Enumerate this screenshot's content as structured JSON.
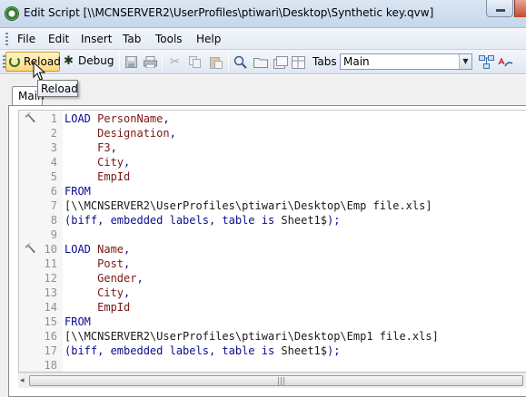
{
  "window": {
    "title": "Edit Script [\\\\MCNSERVER2\\UserProfiles\\ptiwari\\Desktop\\Synthetic key.qvw]"
  },
  "menu": {
    "items": [
      "File",
      "Edit",
      "Insert",
      "Tab",
      "Tools",
      "Help"
    ]
  },
  "toolbar": {
    "reload_label": "Reload",
    "debug_label": "Debug",
    "tabs_label": "Tabs",
    "tabs_selected": "Main",
    "icons": [
      "save-icon",
      "print-icon",
      "cut-icon",
      "copy-icon",
      "paste-icon",
      "find-icon",
      "open-folder-icon",
      "table-files-icon",
      "table-icon",
      "tab-icon",
      "variables-icon"
    ]
  },
  "tooltip": {
    "text": "Reload"
  },
  "tabs": [
    {
      "label": "Main"
    }
  ],
  "editor": {
    "lines": [
      {
        "n": "1",
        "parts": [
          [
            "kw",
            "LOAD "
          ],
          [
            "fld",
            "PersonName"
          ],
          [
            "kw",
            ","
          ]
        ]
      },
      {
        "n": "2",
        "parts": [
          [
            "kw",
            "     "
          ],
          [
            "fld",
            "Designation"
          ],
          [
            "kw",
            ","
          ]
        ]
      },
      {
        "n": "3",
        "parts": [
          [
            "kw",
            "     "
          ],
          [
            "fld",
            "F3"
          ],
          [
            "kw",
            ","
          ]
        ]
      },
      {
        "n": "4",
        "parts": [
          [
            "kw",
            "     "
          ],
          [
            "fld",
            "City"
          ],
          [
            "kw",
            ","
          ]
        ]
      },
      {
        "n": "5",
        "parts": [
          [
            "kw",
            "     "
          ],
          [
            "fld",
            "EmpId"
          ]
        ]
      },
      {
        "n": "6",
        "parts": [
          [
            "kw",
            "FROM"
          ]
        ]
      },
      {
        "n": "7",
        "parts": [
          [
            "path",
            "[\\\\MCNSERVER2\\UserProfiles\\ptiwari\\Desktop\\Emp file.xls]"
          ]
        ]
      },
      {
        "n": "8",
        "parts": [
          [
            "kw",
            "(biff, embedded labels, table is "
          ],
          [
            "path",
            "Sheet1$"
          ],
          [
            "kw",
            ");"
          ]
        ]
      },
      {
        "n": "9",
        "parts": []
      },
      {
        "n": "10",
        "parts": [
          [
            "kw",
            "LOAD "
          ],
          [
            "fld",
            "Name"
          ],
          [
            "kw",
            ","
          ]
        ]
      },
      {
        "n": "11",
        "parts": [
          [
            "kw",
            "     "
          ],
          [
            "fld",
            "Post"
          ],
          [
            "kw",
            ","
          ]
        ]
      },
      {
        "n": "12",
        "parts": [
          [
            "kw",
            "     "
          ],
          [
            "fld",
            "Gender"
          ],
          [
            "kw",
            ","
          ]
        ]
      },
      {
        "n": "13",
        "parts": [
          [
            "kw",
            "     "
          ],
          [
            "fld",
            "City"
          ],
          [
            "kw",
            ","
          ]
        ]
      },
      {
        "n": "14",
        "parts": [
          [
            "kw",
            "     "
          ],
          [
            "fld",
            "EmpId"
          ]
        ]
      },
      {
        "n": "15",
        "parts": [
          [
            "kw",
            "FROM"
          ]
        ]
      },
      {
        "n": "16",
        "parts": [
          [
            "path",
            "[\\\\MCNSERVER2\\UserProfiles\\ptiwari\\Desktop\\Emp1 file.xls]"
          ]
        ]
      },
      {
        "n": "17",
        "parts": [
          [
            "kw",
            "(biff, embedded labels, table is "
          ],
          [
            "path",
            "Sheet1$"
          ],
          [
            "kw",
            ");"
          ]
        ]
      },
      {
        "n": "18",
        "parts": []
      }
    ],
    "fold_lines": [
      "1",
      "10"
    ]
  },
  "colors": {
    "keyword": "#0b0b8e",
    "field": "#7a1616",
    "line_number": "#909090",
    "reload_highlight": "#ffd87a"
  }
}
